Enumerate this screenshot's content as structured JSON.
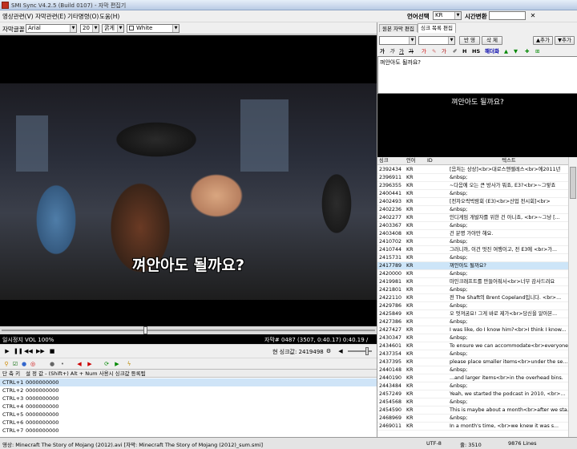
{
  "window": {
    "title": "SMI Sync V4.2.5 (Build 0107) - 자막 편집기"
  },
  "menu": [
    {
      "label": "영상관련(V)"
    },
    {
      "label": "자막관련(E)"
    },
    {
      "label": "기타명령(O)"
    },
    {
      "label": "도움(H)"
    }
  ],
  "top_right": {
    "lang_label": "언어선택",
    "lang_value": "KR",
    "time_label": "시간변환",
    "time_value": "",
    "close_icon": "✕"
  },
  "fontbar": {
    "label": "자막글꼴",
    "font": "Arial",
    "size": "20",
    "weight": "굵게",
    "color": "White"
  },
  "video": {
    "subtitle": "껴안아도 될까요?"
  },
  "status_line": {
    "left": "일시정지  VOL 100%",
    "right": "자막# 0487 (3507, 0:40.17)   0:40.19 / 1:44:17"
  },
  "transport": {
    "sync_label": "현 싱크값: 2419498"
  },
  "hotkeys": {
    "header_key": "단 축 키",
    "header_value": "설 정 값  - (Shift+) Alt + Num 사용시 싱크값 등록됨",
    "rows": [
      {
        "key": "CTRL+1",
        "value": "0000000000"
      },
      {
        "key": "CTRL+2",
        "value": "0000000000"
      },
      {
        "key": "CTRL+3",
        "value": "0000000000"
      },
      {
        "key": "CTRL+4",
        "value": "0000000000"
      },
      {
        "key": "CTRL+5",
        "value": "0000000000"
      },
      {
        "key": "CTRL+6",
        "value": "0000000000"
      },
      {
        "key": "CTRL+7",
        "value": "0000000000"
      }
    ]
  },
  "right_panel": {
    "tabs": [
      "원본 자막 편집",
      "싱크 목록 편집"
    ],
    "buttons": {
      "reflect": "반 영",
      "delete": "삭 제",
      "add1": "▲추가",
      "add2": "▼추가"
    },
    "fmt_items": [
      "가",
      "가",
      "가",
      "가",
      "가",
      "가",
      "H",
      "HS",
      "해더화"
    ],
    "editor_text": "껴안아도 될까요?",
    "preview_text": "껴안아도 될까요?",
    "columns": [
      "싱크",
      "언어",
      "ID",
      "텍스트"
    ],
    "rows": [
      {
        "sync": "2392434",
        "lang": "KR",
        "id": "",
        "text": "[음처는 상상]<br>대로스앤젤레스<br>에2011년"
      },
      {
        "sync": "2396911",
        "lang": "KR",
        "id": "",
        "text": "&nbsp;"
      },
      {
        "sync": "2396355",
        "lang": "KR",
        "id": "",
        "text": "~다음에 오는 큰 방사가 뭐죠, E3?<br>~그렇죠"
      },
      {
        "sync": "2400441",
        "lang": "KR",
        "id": "",
        "text": "&nbsp;"
      },
      {
        "sync": "2402493",
        "lang": "KR",
        "id": "",
        "text": "[전자오락박람회 (E3)<br>산업 전시회]<br>"
      },
      {
        "sync": "2402236",
        "lang": "KR",
        "id": "",
        "text": "&nbsp;"
      },
      {
        "sync": "2402277",
        "lang": "KR",
        "id": "",
        "text": "인디게임 개발자를 위한 건 아니죠, <br>~그냥 [..."
      },
      {
        "sync": "2403367",
        "lang": "KR",
        "id": "",
        "text": "&nbsp;"
      },
      {
        "sync": "2403408",
        "lang": "KR",
        "id": "",
        "text": "건 분명 가야만 해요."
      },
      {
        "sync": "2410702",
        "lang": "KR",
        "id": "",
        "text": "&nbsp;"
      },
      {
        "sync": "2410744",
        "lang": "KR",
        "id": "",
        "text": "그러니까, 이건 멋진 여행이고, 전 E3에 <br>가..."
      },
      {
        "sync": "2415731",
        "lang": "KR",
        "id": "",
        "text": "&nbsp;"
      },
      {
        "sync": "2417789",
        "lang": "KR",
        "id": "",
        "text": "껴안아도 될까요?"
      },
      {
        "sync": "2420000",
        "lang": "KR",
        "id": "",
        "text": "&nbsp;"
      },
      {
        "sync": "2419981",
        "lang": "KR",
        "id": "",
        "text": "마인크래프트를 만들어줘서<br>너무 감사드려요"
      },
      {
        "sync": "2421801",
        "lang": "KR",
        "id": "",
        "text": "&nbsp;"
      },
      {
        "sync": "2422110",
        "lang": "KR",
        "id": "",
        "text": "전 The Shaft의 Brent Copeland입니다. <br>..."
      },
      {
        "sync": "2429786",
        "lang": "KR",
        "id": "",
        "text": "&nbsp;"
      },
      {
        "sync": "2425849",
        "lang": "KR",
        "id": "",
        "text": "오 멋져굼요! 그게 바로 제가<br>당신을 알아본..."
      },
      {
        "sync": "2427386",
        "lang": "KR",
        "id": "",
        "text": "&nbsp;"
      },
      {
        "sync": "2427427",
        "lang": "KR",
        "id": "",
        "text": "I was like, do I know him?<br>I think I know..."
      },
      {
        "sync": "2430347",
        "lang": "KR",
        "id": "",
        "text": "&nbsp;"
      },
      {
        "sync": "2434601",
        "lang": "KR",
        "id": "",
        "text": "To ensure we can accommodate<br>everyone..."
      },
      {
        "sync": "2437354",
        "lang": "KR",
        "id": "",
        "text": "&nbsp;"
      },
      {
        "sync": "2437395",
        "lang": "KR",
        "id": "",
        "text": "please place smaller items<br>under the se..."
      },
      {
        "sync": "2440148",
        "lang": "KR",
        "id": "",
        "text": "&nbsp;"
      },
      {
        "sync": "2440190",
        "lang": "KR",
        "id": "",
        "text": "...and larger items<br>in the overhead bins."
      },
      {
        "sync": "2443484",
        "lang": "KR",
        "id": "",
        "text": "&nbsp;"
      },
      {
        "sync": "2457249",
        "lang": "KR",
        "id": "",
        "text": "Yeah, we started the podcast in 2010, <br>..."
      },
      {
        "sync": "2454568",
        "lang": "KR",
        "id": "",
        "text": "&nbsp;"
      },
      {
        "sync": "2454590",
        "lang": "KR",
        "id": "",
        "text": "This is maybe about a month<br>after we sta..."
      },
      {
        "sync": "2468969",
        "lang": "KR",
        "id": "",
        "text": "&nbsp;"
      },
      {
        "sync": "2469011",
        "lang": "KR",
        "id": "",
        "text": "In a month's time, <br>we knew it was s..."
      }
    ]
  },
  "statusbar": {
    "file": "영상: Minecraft The Story of Mojang (2012).avi  [자막: Minecraft The Story of Mojang (2012)_sum.smi]",
    "encoding": "UTF-8",
    "position": "줄: 3510",
    "lines": "9876 Lines"
  }
}
